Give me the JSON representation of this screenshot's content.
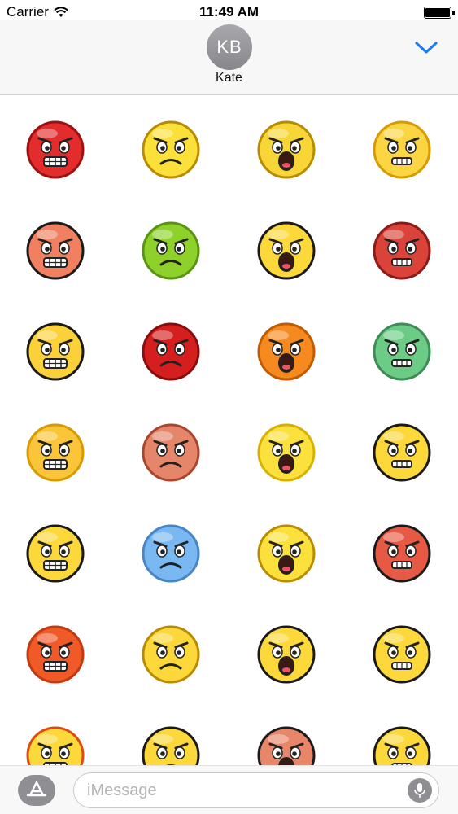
{
  "status_bar": {
    "carrier": "Carrier",
    "time": "11:49 AM",
    "battery_level": 1.0
  },
  "header": {
    "avatar_initials": "KB",
    "contact_name": "Kate"
  },
  "stickers": [
    {
      "name": "red-grimace-sticker",
      "face": "#e32c2c",
      "edge": "#9c1212"
    },
    {
      "name": "suspicious-tongue-sticker",
      "face": "#fce03a",
      "edge": "#b98b00"
    },
    {
      "name": "cigar-frown-sticker",
      "face": "#f8d637",
      "edge": "#b98b00"
    },
    {
      "name": "blushing-grin-sticker",
      "face": "#fbd642",
      "edge": "#d99a00"
    },
    {
      "name": "heart-grin-sticker",
      "face": "#f08060",
      "edge": "#1a1a1a"
    },
    {
      "name": "green-nauseous-sticker",
      "face": "#8fd12b",
      "edge": "#5a9412"
    },
    {
      "name": "screaming-outline-sticker",
      "face": "#fcd83a",
      "edge": "#1a1a1a"
    },
    {
      "name": "red-devil-sticker",
      "face": "#d9433a",
      "edge": "#8c1a16"
    },
    {
      "name": "yelling-goggle-sticker",
      "face": "#fbd13a",
      "edge": "#1a1a1a"
    },
    {
      "name": "angry-red-heart-sticker",
      "face": "#d51f1f",
      "edge": "#8a0c0c"
    },
    {
      "name": "orange-fists-sticker",
      "face": "#f78a1e",
      "edge": "#c25a00"
    },
    {
      "name": "green-cyborg-sticker",
      "face": "#6ccc86",
      "edge": "#3b8d55"
    },
    {
      "name": "annoyed-frown-sticker",
      "face": "#fbc53a",
      "edge": "#d99a00"
    },
    {
      "name": "devil-heart-sticker",
      "face": "#e5866a",
      "edge": "#a8462e"
    },
    {
      "name": "yellow-grimace-sticker",
      "face": "#fce13d",
      "edge": "#d9b000"
    },
    {
      "name": "shouting-outline-sticker",
      "face": "#fcd83a",
      "edge": "#1a1a1a"
    },
    {
      "name": "big-grin-outline-sticker",
      "face": "#fcd83a",
      "edge": "#1a1a1a"
    },
    {
      "name": "blue-squint-sticker",
      "face": "#79b8f0",
      "edge": "#4785c4"
    },
    {
      "name": "green-eyed-grimace-sticker",
      "face": "#fce13d",
      "edge": "#b98b00"
    },
    {
      "name": "red-horned-grimace-sticker",
      "face": "#e65a45",
      "edge": "#1a1a1a"
    },
    {
      "name": "red-purple-eyes-sticker",
      "face": "#f05a28",
      "edge": "#c23a10"
    },
    {
      "name": "tongue-yell-sticker",
      "face": "#fcd83a",
      "edge": "#b98b00"
    },
    {
      "name": "skeptical-outline-sticker",
      "face": "#fcd83a",
      "edge": "#1a1a1a"
    },
    {
      "name": "wide-eye-grimace-sticker",
      "face": "#fcd83a",
      "edge": "#1a1a1a"
    },
    {
      "name": "flaming-head-sticker",
      "face": "#fcd83a",
      "edge": "#e04a10"
    },
    {
      "name": "eyepatch-sticker",
      "face": "#fcd83a",
      "edge": "#1a1a1a"
    },
    {
      "name": "pirate-heart-sticker",
      "face": "#e8866a",
      "edge": "#1a1a1a"
    },
    {
      "name": "smirk-outline-sticker",
      "face": "#fcd83a",
      "edge": "#1a1a1a"
    }
  ],
  "compose": {
    "placeholder": "iMessage"
  },
  "icons": {
    "wifi": "wifi-icon",
    "collapse": "chevron-down-icon",
    "appstore": "app-store-icon",
    "mic": "microphone-icon"
  },
  "colors": {
    "accent": "#1a7cf4",
    "header_bg": "#f7f7f7",
    "avatar": "#98989d"
  }
}
